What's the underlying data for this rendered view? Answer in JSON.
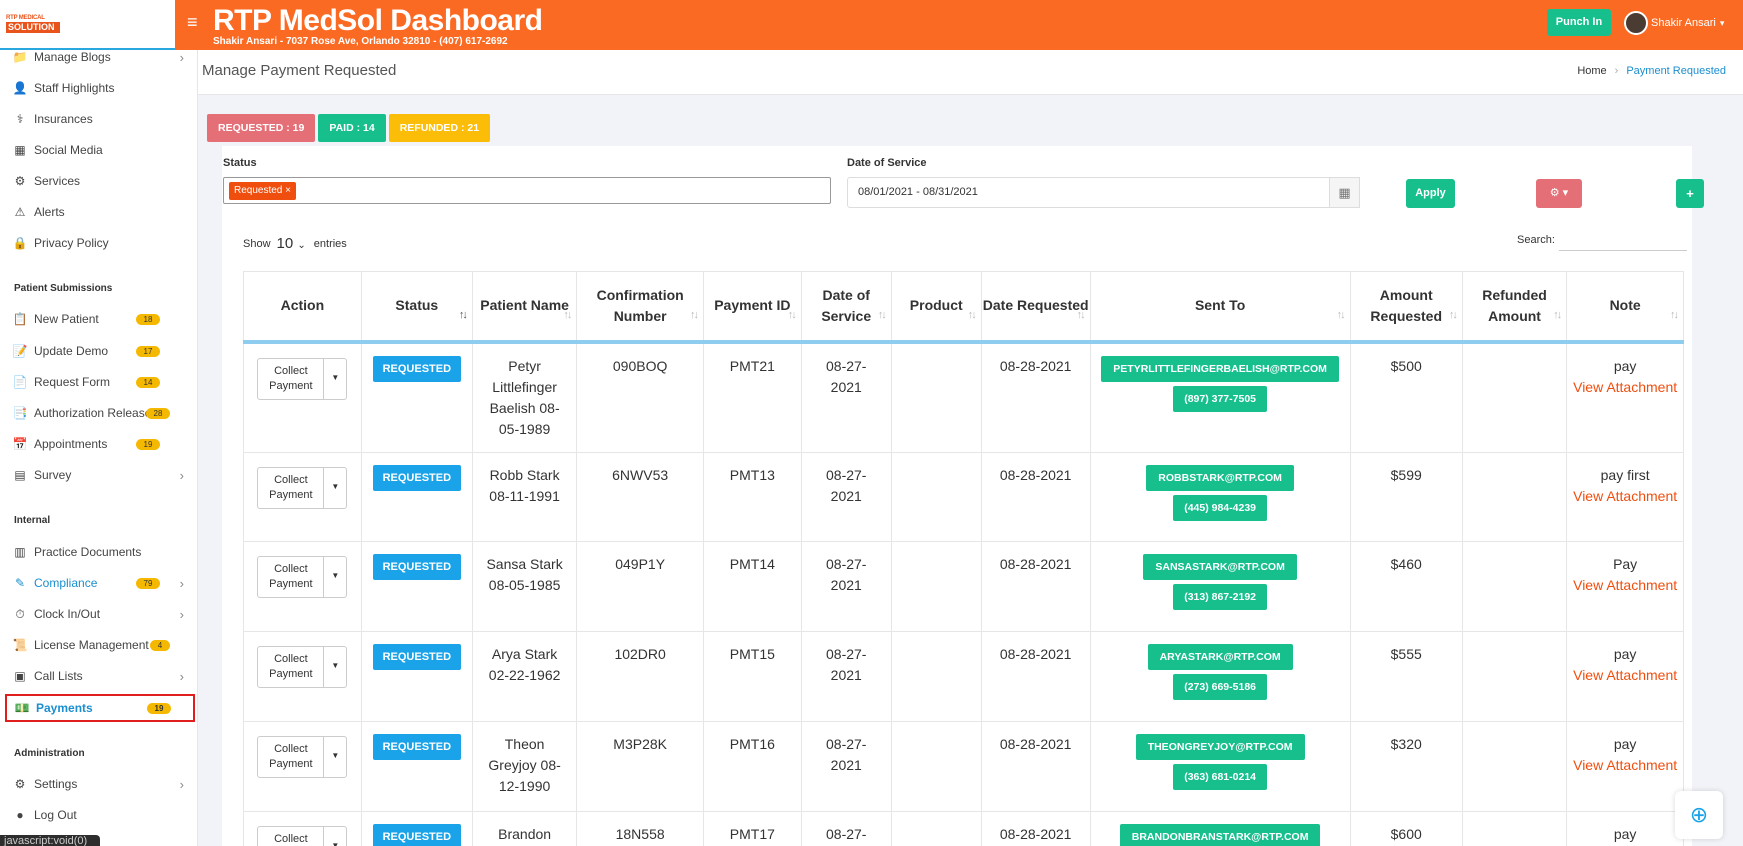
{
  "header": {
    "title": "RTP MedSol Dashboard",
    "subtitle": "Shakir Ansari - 7037 Rose Ave, Orlando 32810 - (407) 617-2692",
    "punch_in": "Punch In",
    "user_name": "Shakir Ansari",
    "logo_top": "RTP MEDICAL",
    "logo_bottom": "SOLUTION"
  },
  "sidebar": {
    "items": [
      {
        "label": "Manage Blogs"
      },
      {
        "label": "Staff Highlights"
      },
      {
        "label": "Insurances"
      },
      {
        "label": "Social Media"
      },
      {
        "label": "Services"
      },
      {
        "label": "Alerts"
      },
      {
        "label": "Privacy Policy"
      }
    ],
    "section_patient": "Patient Submissions",
    "patient_items": [
      {
        "label": "New Patient",
        "badge": "18"
      },
      {
        "label": "Update Demo",
        "badge": "17"
      },
      {
        "label": "Request Form",
        "badge": "14"
      },
      {
        "label": "Authorization Release",
        "badge": "28"
      },
      {
        "label": "Appointments",
        "badge": "19"
      },
      {
        "label": "Survey"
      }
    ],
    "section_internal": "Internal",
    "internal_items": [
      {
        "label": "Practice Documents"
      },
      {
        "label": "Compliance",
        "badge": "79"
      },
      {
        "label": "Clock In/Out"
      },
      {
        "label": "License Management",
        "badge": "4"
      },
      {
        "label": "Call Lists"
      },
      {
        "label": "Payments",
        "badge": "19"
      }
    ],
    "section_admin": "Administration",
    "admin_items": [
      {
        "label": "Settings"
      },
      {
        "label": "Log Out"
      }
    ],
    "status_tooltip": "javascript:void(0)"
  },
  "subheader": {
    "title": "Manage Payment Requested",
    "breadcrumb_home": "Home",
    "breadcrumb_current": "Payment Requested"
  },
  "pills": {
    "requested": "REQUESTED : 19",
    "paid": "PAID : 14",
    "refunded": "REFUNDED : 21"
  },
  "filters": {
    "status_label": "Status",
    "status_tag": "Requested ×",
    "date_label": "Date of Service",
    "date_value": "08/01/2021 - 08/31/2021",
    "apply": "Apply",
    "gear": "⚙ ▾",
    "plus": "+",
    "show_label": "Show",
    "show_value": "10",
    "entries_label": "entries",
    "search_label": "Search:"
  },
  "table": {
    "headers": [
      "Action",
      "Status",
      "Patient Name",
      "Confirmation Number",
      "Payment ID",
      "Date of Service",
      "Product",
      "Date Requested",
      "Sent To",
      "Amount Requested",
      "Refunded Amount",
      "Note"
    ],
    "action_label": "Collect Payment",
    "view_label": "View Attachment",
    "rows": [
      {
        "status": "REQUESTED",
        "patient": "Petyr Littlefinger Baelish 08-05-1989",
        "conf": "090BOQ",
        "pid": "PMT21",
        "dos": "08-27-2021",
        "product": "",
        "req": "08-28-2021",
        "email": "PETYRLITTLEFINGERBAELISH@RTP.COM",
        "phone": "(897) 377-7505",
        "amount": "$500",
        "refunded": "",
        "note": "pay"
      },
      {
        "status": "REQUESTED",
        "patient": "Robb Stark 08-11-1991",
        "conf": "6NWV53",
        "pid": "PMT13",
        "dos": "08-27-2021",
        "product": "",
        "req": "08-28-2021",
        "email": "ROBBSTARK@RTP.COM",
        "phone": "(445) 984-4239",
        "amount": "$599",
        "refunded": "",
        "note": "pay first"
      },
      {
        "status": "REQUESTED",
        "patient": "Sansa Stark 08-05-1985",
        "conf": "049P1Y",
        "pid": "PMT14",
        "dos": "08-27-2021",
        "product": "",
        "req": "08-28-2021",
        "email": "SANSASTARK@RTP.COM",
        "phone": "(313) 867-2192",
        "amount": "$460",
        "refunded": "",
        "note": "Pay"
      },
      {
        "status": "REQUESTED",
        "patient": "Arya Stark 02-22-1962",
        "conf": "102DR0",
        "pid": "PMT15",
        "dos": "08-27-2021",
        "product": "",
        "req": "08-28-2021",
        "email": "ARYASTARK@RTP.COM",
        "phone": "(273) 669-5186",
        "amount": "$555",
        "refunded": "",
        "note": "pay"
      },
      {
        "status": "REQUESTED",
        "patient": "Theon Greyjoy 08-12-1990",
        "conf": "M3P28K",
        "pid": "PMT16",
        "dos": "08-27-2021",
        "product": "",
        "req": "08-28-2021",
        "email": "THEONGREYJOY@RTP.COM",
        "phone": "(363) 681-0214",
        "amount": "$320",
        "refunded": "",
        "note": "pay"
      },
      {
        "status": "REQUESTED",
        "patient": "Brandon",
        "conf": "18N558",
        "pid": "PMT17",
        "dos": "08-27-",
        "product": "",
        "req": "08-28-2021",
        "email": "BRANDONBRANSTARK@RTP.COM",
        "phone": "",
        "amount": "$600",
        "refunded": "",
        "note": "pay"
      }
    ]
  }
}
